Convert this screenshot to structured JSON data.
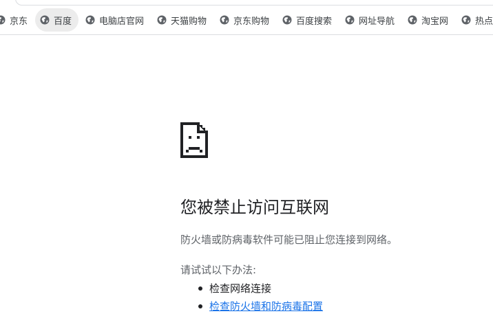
{
  "bookmarks_bar": {
    "items": [
      {
        "label": "京东"
      },
      {
        "label": "百度"
      },
      {
        "label": "电脑店官网"
      },
      {
        "label": "天猫购物"
      },
      {
        "label": "京东购物"
      },
      {
        "label": "百度搜索"
      },
      {
        "label": "网址导航"
      },
      {
        "label": "淘宝网"
      },
      {
        "label": "热点"
      }
    ],
    "active_item": "百度",
    "icon": "globe-icon"
  },
  "error_page": {
    "icon": "sad-document-icon",
    "title": "您被禁止访问互联网",
    "description": "防火墙或防病毒软件可能已阻止您连接到网络。",
    "try_label": "请试试以下办法:",
    "suggestions": [
      {
        "text": "检查网络连接",
        "is_link": false
      },
      {
        "text": "检查防火墙和防病毒配置",
        "is_link": true
      }
    ]
  },
  "colors": {
    "link": "#1a73e8",
    "title": "#202124",
    "secondary_text": "#5f6368",
    "active_bookmark_bg": "#ececec"
  }
}
